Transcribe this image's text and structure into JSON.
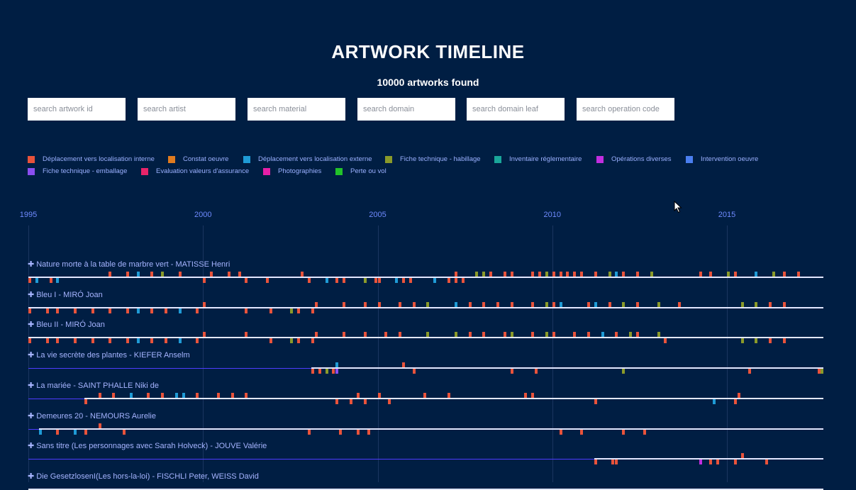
{
  "title": "ARTWORK TIMELINE",
  "count_text": "10000 artworks found",
  "search": [
    {
      "placeholder": "search artwork id"
    },
    {
      "placeholder": "search artist"
    },
    {
      "placeholder": "search material"
    },
    {
      "placeholder": "search domain"
    },
    {
      "placeholder": "search domain leaf"
    },
    {
      "placeholder": "search operation code"
    }
  ],
  "legend": [
    {
      "label": "Déplacement vers localisation interne",
      "color": "#e8533b"
    },
    {
      "label": "Constat oeuvre",
      "color": "#e07b1f"
    },
    {
      "label": "Déplacement vers localisation externe",
      "color": "#1f9bd6"
    },
    {
      "label": "Fiche technique - habillage",
      "color": "#8a9a2a"
    },
    {
      "label": "Inventaire réglementaire",
      "color": "#1aa69a"
    },
    {
      "label": "Opérations diverses",
      "color": "#c22ee0"
    },
    {
      "label": "Intervention oeuvre",
      "color": "#4a7ef0"
    },
    {
      "label": "Fiche technique - emballage",
      "color": "#8a4ef0"
    },
    {
      "label": "Evaluation valeurs d'assurance",
      "color": "#e8246a"
    },
    {
      "label": "Photographies",
      "color": "#e61fa8"
    },
    {
      "label": "Perte ou vol",
      "color": "#22c22a"
    }
  ],
  "axis": {
    "years": [
      "1995",
      "2000",
      "2005",
      "2010",
      "2015"
    ]
  },
  "rows": [
    {
      "label": "Nature morte à la table de marbre vert - MATISSE Henri",
      "span": [
        1995.0,
        2017.8
      ],
      "events": [
        [
          1995.0,
          0,
          0
        ],
        [
          1995.2,
          2,
          0
        ],
        [
          1995.6,
          0,
          0
        ],
        [
          1995.8,
          2,
          0
        ],
        [
          1997.3,
          0,
          1
        ],
        [
          1997.8,
          0,
          1
        ],
        [
          1998.1,
          2,
          1
        ],
        [
          1998.5,
          0,
          1
        ],
        [
          1998.8,
          3,
          1
        ],
        [
          1999.3,
          0,
          1
        ],
        [
          2000.0,
          0,
          0
        ],
        [
          2000.2,
          0,
          1
        ],
        [
          2000.7,
          0,
          1
        ],
        [
          2001.0,
          0,
          1
        ],
        [
          2001.2,
          0,
          0
        ],
        [
          2001.8,
          0,
          0
        ],
        [
          2002.8,
          0,
          1
        ],
        [
          2003.0,
          0,
          0
        ],
        [
          2003.5,
          2,
          0
        ],
        [
          2003.8,
          0,
          0
        ],
        [
          2004.0,
          0,
          0
        ],
        [
          2004.6,
          3,
          0
        ],
        [
          2004.9,
          0,
          0
        ],
        [
          2005.0,
          0,
          0
        ],
        [
          2005.5,
          2,
          0
        ],
        [
          2005.7,
          0,
          0
        ],
        [
          2005.9,
          0,
          0
        ],
        [
          2006.6,
          2,
          0
        ],
        [
          2007.0,
          0,
          0
        ],
        [
          2007.2,
          0,
          0
        ],
        [
          2007.2,
          0,
          1
        ],
        [
          2007.4,
          0,
          0
        ],
        [
          2007.8,
          3,
          1
        ],
        [
          2008.0,
          3,
          1
        ],
        [
          2008.2,
          0,
          1
        ],
        [
          2008.6,
          0,
          1
        ],
        [
          2008.8,
          0,
          1
        ],
        [
          2009.4,
          0,
          1
        ],
        [
          2009.6,
          0,
          1
        ],
        [
          2009.8,
          3,
          1
        ],
        [
          2010.0,
          0,
          1
        ],
        [
          2010.2,
          0,
          1
        ],
        [
          2010.4,
          0,
          1
        ],
        [
          2010.6,
          0,
          1
        ],
        [
          2010.8,
          0,
          1
        ],
        [
          2011.2,
          0,
          1
        ],
        [
          2011.6,
          3,
          1
        ],
        [
          2011.8,
          2,
          1
        ],
        [
          2012.0,
          0,
          1
        ],
        [
          2012.4,
          0,
          1
        ],
        [
          2012.8,
          3,
          1
        ],
        [
          2014.2,
          0,
          1
        ],
        [
          2014.5,
          0,
          1
        ],
        [
          2015.0,
          3,
          1
        ],
        [
          2015.2,
          0,
          1
        ],
        [
          2015.8,
          2,
          1
        ],
        [
          2016.3,
          3,
          1
        ],
        [
          2016.6,
          0,
          1
        ],
        [
          2017.0,
          0,
          1
        ]
      ]
    },
    {
      "label": "Bleu I - MIRÓ Joan",
      "span": [
        1995.0,
        2017.8
      ],
      "events": [
        [
          1995.0,
          0,
          0
        ],
        [
          1995.5,
          0,
          0
        ],
        [
          1995.8,
          0,
          0
        ],
        [
          1996.3,
          0,
          0
        ],
        [
          1996.8,
          0,
          0
        ],
        [
          1997.3,
          0,
          0
        ],
        [
          1997.8,
          0,
          0
        ],
        [
          1998.1,
          2,
          0
        ],
        [
          1998.5,
          0,
          0
        ],
        [
          1998.9,
          0,
          0
        ],
        [
          1999.3,
          2,
          0
        ],
        [
          1999.8,
          0,
          0
        ],
        [
          2000.0,
          0,
          1
        ],
        [
          2001.2,
          0,
          0
        ],
        [
          2001.9,
          0,
          0
        ],
        [
          2002.5,
          3,
          0
        ],
        [
          2002.7,
          0,
          0
        ],
        [
          2003.1,
          0,
          0
        ],
        [
          2003.2,
          0,
          1
        ],
        [
          2004.0,
          0,
          1
        ],
        [
          2004.6,
          0,
          1
        ],
        [
          2005.0,
          0,
          1
        ],
        [
          2005.6,
          0,
          1
        ],
        [
          2006.0,
          0,
          1
        ],
        [
          2006.4,
          3,
          1
        ],
        [
          2007.2,
          2,
          1
        ],
        [
          2007.6,
          0,
          1
        ],
        [
          2008.0,
          0,
          1
        ],
        [
          2008.4,
          0,
          1
        ],
        [
          2008.8,
          0,
          1
        ],
        [
          2009.4,
          0,
          1
        ],
        [
          2009.8,
          3,
          1
        ],
        [
          2010.0,
          0,
          1
        ],
        [
          2010.2,
          2,
          1
        ],
        [
          2011.0,
          0,
          1
        ],
        [
          2011.2,
          2,
          1
        ],
        [
          2011.6,
          0,
          1
        ],
        [
          2012.0,
          3,
          1
        ],
        [
          2012.4,
          0,
          1
        ],
        [
          2013.0,
          3,
          1
        ],
        [
          2013.6,
          0,
          1
        ],
        [
          2015.4,
          3,
          1
        ],
        [
          2015.8,
          3,
          1
        ],
        [
          2016.2,
          0,
          1
        ],
        [
          2016.6,
          0,
          1
        ]
      ]
    },
    {
      "label": "Bleu II - MIRÓ Joan",
      "span": [
        1995.0,
        2017.8
      ],
      "events": [
        [
          1995.0,
          0,
          0
        ],
        [
          1995.5,
          0,
          0
        ],
        [
          1995.8,
          0,
          0
        ],
        [
          1996.3,
          0,
          0
        ],
        [
          1996.8,
          0,
          0
        ],
        [
          1997.3,
          0,
          0
        ],
        [
          1997.8,
          0,
          0
        ],
        [
          1998.1,
          2,
          0
        ],
        [
          1998.5,
          0,
          0
        ],
        [
          1998.9,
          0,
          0
        ],
        [
          1999.3,
          2,
          0
        ],
        [
          1999.8,
          0,
          0
        ],
        [
          2000.0,
          0,
          1
        ],
        [
          2001.2,
          0,
          1
        ],
        [
          2001.9,
          0,
          0
        ],
        [
          2002.5,
          3,
          0
        ],
        [
          2002.7,
          0,
          0
        ],
        [
          2003.1,
          0,
          0
        ],
        [
          2003.2,
          0,
          1
        ],
        [
          2004.0,
          0,
          1
        ],
        [
          2004.6,
          0,
          1
        ],
        [
          2005.2,
          0,
          1
        ],
        [
          2005.6,
          0,
          1
        ],
        [
          2006.4,
          3,
          1
        ],
        [
          2007.2,
          3,
          1
        ],
        [
          2007.6,
          0,
          1
        ],
        [
          2008.0,
          0,
          1
        ],
        [
          2008.6,
          0,
          1
        ],
        [
          2008.8,
          3,
          1
        ],
        [
          2009.4,
          0,
          1
        ],
        [
          2009.8,
          3,
          1
        ],
        [
          2010.0,
          0,
          1
        ],
        [
          2010.6,
          0,
          1
        ],
        [
          2011.0,
          0,
          1
        ],
        [
          2011.4,
          2,
          1
        ],
        [
          2011.8,
          0,
          1
        ],
        [
          2012.2,
          3,
          1
        ],
        [
          2012.4,
          0,
          1
        ],
        [
          2013.0,
          3,
          1
        ],
        [
          2013.2,
          0,
          0
        ],
        [
          2015.4,
          3,
          0
        ],
        [
          2015.8,
          3,
          0
        ],
        [
          2016.2,
          0,
          0
        ],
        [
          2016.6,
          0,
          0
        ]
      ]
    },
    {
      "label": "La vie secrète des plantes - KIEFER Anselm",
      "span": [
        2003.1,
        2017.8
      ],
      "events": [
        [
          2003.1,
          0,
          0
        ],
        [
          2003.3,
          0,
          0
        ],
        [
          2003.5,
          3,
          0
        ],
        [
          2003.7,
          0,
          0
        ],
        [
          2003.8,
          2,
          1
        ],
        [
          2003.8,
          7,
          0
        ],
        [
          2005.7,
          0,
          1
        ],
        [
          2006.0,
          0,
          0
        ],
        [
          2008.8,
          0,
          0
        ],
        [
          2009.5,
          0,
          0
        ],
        [
          2012.0,
          3,
          0
        ],
        [
          2015.6,
          0,
          0
        ],
        [
          2017.6,
          0,
          0
        ],
        [
          2017.8,
          3,
          0
        ]
      ]
    },
    {
      "label": "La mariée - SAINT PHALLE Niki de",
      "span": [
        1996.6,
        2017.8
      ],
      "events": [
        [
          1996.6,
          0,
          0
        ],
        [
          1997.0,
          0,
          1
        ],
        [
          1997.4,
          0,
          1
        ],
        [
          1997.9,
          2,
          1
        ],
        [
          1998.4,
          0,
          1
        ],
        [
          1998.8,
          0,
          1
        ],
        [
          1999.2,
          2,
          1
        ],
        [
          1999.4,
          2,
          1
        ],
        [
          1999.8,
          0,
          1
        ],
        [
          2000.4,
          0,
          1
        ],
        [
          2000.8,
          0,
          1
        ],
        [
          2001.2,
          0,
          1
        ],
        [
          2003.8,
          0,
          0
        ],
        [
          2004.2,
          0,
          0
        ],
        [
          2004.4,
          0,
          1
        ],
        [
          2004.6,
          0,
          0
        ],
        [
          2005.0,
          0,
          1
        ],
        [
          2005.3,
          0,
          0
        ],
        [
          2006.3,
          0,
          1
        ],
        [
          2007.0,
          0,
          1
        ],
        [
          2009.2,
          0,
          1
        ],
        [
          2009.4,
          0,
          1
        ],
        [
          2011.2,
          0,
          0
        ],
        [
          2014.6,
          2,
          0
        ],
        [
          2015.2,
          0,
          0
        ],
        [
          2015.3,
          0,
          1
        ]
      ]
    },
    {
      "label": "Demeures 20 - NEMOURS Aurelie",
      "span": [
        1995.3,
        2017.8
      ],
      "events": [
        [
          1995.3,
          2,
          0
        ],
        [
          1995.8,
          0,
          0
        ],
        [
          1996.3,
          2,
          0
        ],
        [
          1996.6,
          0,
          0
        ],
        [
          1997.0,
          0,
          1
        ],
        [
          1997.7,
          0,
          0
        ],
        [
          2003.0,
          0,
          0
        ],
        [
          2003.9,
          0,
          0
        ],
        [
          2004.4,
          0,
          0
        ],
        [
          2004.7,
          0,
          0
        ],
        [
          2010.2,
          0,
          0
        ],
        [
          2010.8,
          0,
          0
        ],
        [
          2012.0,
          0,
          0
        ],
        [
          2012.6,
          0,
          0
        ]
      ]
    },
    {
      "label": "Sans titre (Les personnages avec Sarah Holveck) - JOUVE Valérie",
      "span": [
        2011.2,
        2017.8
      ],
      "events": [
        [
          2011.2,
          0,
          0
        ],
        [
          2011.7,
          0,
          0
        ],
        [
          2011.8,
          0,
          0
        ],
        [
          2014.2,
          5,
          0
        ],
        [
          2014.5,
          0,
          0
        ],
        [
          2014.7,
          0,
          0
        ],
        [
          2015.2,
          0,
          0
        ],
        [
          2015.4,
          0,
          1
        ],
        [
          2016.1,
          0,
          0
        ]
      ]
    },
    {
      "label": "Die GesetzlosenI(Les hors-la-loi) - FISCHLI Peter, WEISS David",
      "span": [
        1995.0,
        2017.8
      ],
      "events": []
    }
  ]
}
